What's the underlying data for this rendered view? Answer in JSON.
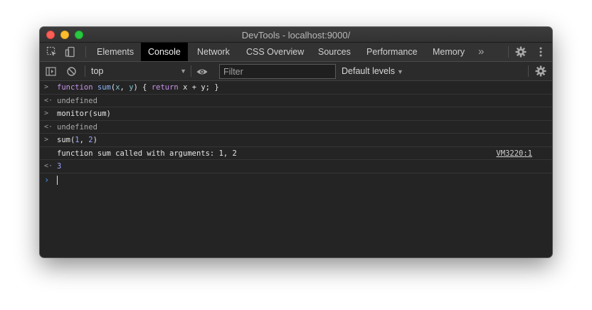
{
  "window": {
    "title": "DevTools - localhost:9000/"
  },
  "tabbar": {
    "inspect_icon": "inspect-element-icon",
    "device_icon": "device-toolbar-icon",
    "tabs": [
      "Elements",
      "Console",
      "Network",
      "CSS Overview",
      "Sources",
      "Performance",
      "Memory"
    ],
    "active_tab": "Console",
    "more_label": "»",
    "settings_icon": "gear-icon",
    "menu_icon": "kebab-menu-icon"
  },
  "console_toolbar": {
    "context": "top",
    "filter_placeholder": "Filter",
    "levels": "Default levels"
  },
  "console": {
    "entries": [
      {
        "type": "input",
        "parts": [
          "function",
          " ",
          "sum",
          "(",
          "x",
          ", ",
          "y",
          ") { ",
          "return",
          " x + y; }"
        ]
      },
      {
        "type": "result",
        "text": "undefined"
      },
      {
        "type": "input",
        "text": "monitor(sum)"
      },
      {
        "type": "result",
        "text": "undefined"
      },
      {
        "type": "input",
        "parts": [
          "sum(",
          "1",
          ", ",
          "2",
          ")"
        ]
      },
      {
        "type": "log",
        "text": "function sum called with arguments: 1, 2",
        "source": "VM3220:1"
      },
      {
        "type": "result",
        "text": "3"
      }
    ]
  },
  "colors": {
    "keyword": "#c792ea",
    "function_name": "#8ab4f8",
    "number": "#9aa5ff",
    "prompt": "#4a90e2"
  }
}
